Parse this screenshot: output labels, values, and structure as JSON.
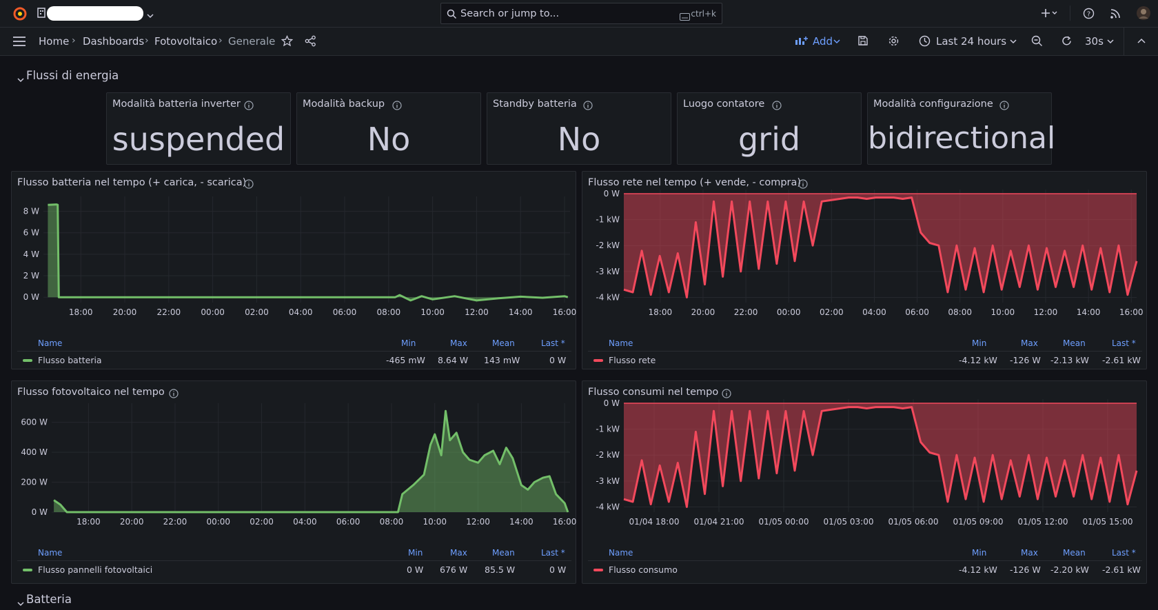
{
  "app": {
    "search_placeholder": "Search or jump to...",
    "search_shortcut": "ctrl+k"
  },
  "breadcrumb": [
    "Home",
    "Dashboards",
    "Fotovoltaico",
    "Generale"
  ],
  "toolbar": {
    "add_label": "Add",
    "time_range": "Last 24 hours",
    "refresh_interval": "30s"
  },
  "rows": {
    "energy_flows": "Flussi di energia",
    "battery": "Batteria"
  },
  "stats": [
    {
      "title": "Modalità batteria inverter",
      "value": "suspended"
    },
    {
      "title": "Modalità backup",
      "value": "No"
    },
    {
      "title": "Standby batteria",
      "value": "No"
    },
    {
      "title": "Luogo contatore",
      "value": "grid"
    },
    {
      "title": "Modalità configurazione",
      "value": "bidirectional"
    }
  ],
  "colors": {
    "green": "#73bf69",
    "red": "#f2495c",
    "link": "#6e9fff",
    "panel_bg": "#181b1f",
    "page_bg": "#111217"
  },
  "legend_headers": {
    "name": "Name",
    "min": "Min",
    "max": "Max",
    "mean": "Mean",
    "last": "Last *"
  },
  "panels": {
    "battery": {
      "title": "Flusso batteria nel tempo (+ carica, - scarica)",
      "series_name": "Flusso batteria",
      "min": "-465 mW",
      "max": "8.64 W",
      "mean": "143 mW",
      "last": "0 W"
    },
    "grid": {
      "title": "Flusso rete nel tempo (+ vende, - compra)",
      "series_name": "Flusso rete",
      "min": "-4.12 kW",
      "max": "-126 W",
      "mean": "-2.13 kW",
      "last": "-2.61 kW"
    },
    "pv": {
      "title": "Flusso fotovoltaico nel tempo",
      "series_name": "Flusso pannelli fotovoltaici",
      "min": "0 W",
      "max": "676 W",
      "mean": "85.5 W",
      "last": "0 W"
    },
    "consumption": {
      "title": "Flusso consumi nel tempo",
      "series_name": "Flusso consumo",
      "min": "-4.12 kW",
      "max": "-126 W",
      "mean": "-2.20 kW",
      "last": "-2.61 kW"
    }
  },
  "chart_data": [
    {
      "type": "line",
      "title": "Flusso batteria nel tempo (+ carica, - scarica)",
      "y_ticks": [
        "8 W",
        "6 W",
        "4 W",
        "2 W",
        "0 W"
      ],
      "x_ticks": [
        "18:00",
        "20:00",
        "22:00",
        "00:00",
        "02:00",
        "04:00",
        "06:00",
        "08:00",
        "10:00",
        "12:00",
        "14:00",
        "16:00"
      ],
      "ylim": [
        -0.5,
        9
      ],
      "series": [
        {
          "name": "Flusso batteria",
          "color": "#73bf69",
          "x": [
            16.5,
            16.9,
            16.95,
            17.0,
            8.3,
            8.5,
            9.0,
            9.5,
            10.0,
            11.0,
            12.0,
            13.0,
            14.0,
            15.0,
            16.0,
            16.15
          ],
          "values": [
            8.6,
            8.64,
            8.6,
            0,
            0,
            0.2,
            -0.3,
            0.1,
            -0.2,
            0.1,
            -0.3,
            -0.1,
            0.05,
            -0.05,
            0.1,
            0
          ]
        }
      ]
    },
    {
      "type": "area",
      "title": "Flusso rete nel tempo (+ vende, - compra)",
      "y_ticks": [
        "0 W",
        "-1 kW",
        "-2 kW",
        "-3 kW",
        "-4 kW"
      ],
      "x_ticks": [
        "18:00",
        "20:00",
        "22:00",
        "00:00",
        "02:00",
        "04:00",
        "06:00",
        "08:00",
        "10:00",
        "12:00",
        "14:00",
        "16:00"
      ],
      "ylim": [
        -4.2,
        0
      ],
      "series": [
        {
          "name": "Flusso rete",
          "color": "#f2495c",
          "values": [
            -3.7,
            -3.8,
            -2.2,
            -3.9,
            -2.4,
            -3.8,
            -2.3,
            -4.0,
            -1.1,
            -3.5,
            -0.3,
            -3.2,
            -0.3,
            -3.0,
            -0.3,
            -2.9,
            -0.3,
            -2.7,
            -0.3,
            -2.6,
            -0.3,
            -2.0,
            -0.3,
            -0.25,
            -0.2,
            -0.15,
            -0.15,
            -0.2,
            -0.15,
            -0.15,
            -0.15,
            -0.2,
            -0.15,
            -1.5,
            -1.9,
            -2.0,
            -3.8,
            -2.0,
            -3.7,
            -2.1,
            -3.8,
            -2.0,
            -3.7,
            -2.2,
            -3.6,
            -2.0,
            -3.7,
            -2.1,
            -3.6,
            -2.2,
            -3.6,
            -2.0,
            -3.7,
            -2.1,
            -3.8,
            -2.0,
            -3.9,
            -2.6
          ]
        }
      ]
    },
    {
      "type": "area",
      "title": "Flusso fotovoltaico nel tempo",
      "y_ticks": [
        "600 W",
        "400 W",
        "200 W",
        "0 W"
      ],
      "x_ticks": [
        "18:00",
        "20:00",
        "22:00",
        "00:00",
        "02:00",
        "04:00",
        "06:00",
        "08:00",
        "10:00",
        "12:00",
        "14:00",
        "16:00"
      ],
      "ylim": [
        0,
        700
      ],
      "series": [
        {
          "name": "Flusso pannelli fotovoltaici",
          "color": "#73bf69",
          "x": [
            16.4,
            16.7,
            17.0,
            8.3,
            8.5,
            9.0,
            9.5,
            9.8,
            10.0,
            10.3,
            10.5,
            10.7,
            11.0,
            11.3,
            11.6,
            12.0,
            12.3,
            12.7,
            13.0,
            13.3,
            13.6,
            14.0,
            14.3,
            14.6,
            15.0,
            15.3,
            15.6,
            16.0,
            16.15
          ],
          "values": [
            80,
            50,
            0,
            0,
            120,
            180,
            250,
            450,
            520,
            380,
            676,
            480,
            530,
            400,
            350,
            330,
            380,
            410,
            320,
            430,
            360,
            180,
            150,
            200,
            230,
            240,
            120,
            60,
            0
          ]
        }
      ]
    },
    {
      "type": "area",
      "title": "Flusso consumi nel tempo",
      "y_ticks": [
        "0 W",
        "-1 kW",
        "-2 kW",
        "-3 kW",
        "-4 kW"
      ],
      "x_ticks": [
        "01/04 18:00",
        "01/04 21:00",
        "01/05 00:00",
        "01/05 03:00",
        "01/05 06:00",
        "01/05 09:00",
        "01/05 12:00",
        "01/05 15:00"
      ],
      "ylim": [
        -4.2,
        0
      ],
      "series": [
        {
          "name": "Flusso consumo",
          "color": "#f2495c",
          "values": [
            -3.7,
            -3.8,
            -2.2,
            -3.9,
            -2.4,
            -3.8,
            -2.3,
            -4.0,
            -1.1,
            -3.5,
            -0.3,
            -3.2,
            -0.3,
            -3.0,
            -0.3,
            -2.9,
            -0.3,
            -2.7,
            -0.3,
            -2.6,
            -0.3,
            -2.0,
            -0.3,
            -0.25,
            -0.2,
            -0.15,
            -0.15,
            -0.2,
            -0.15,
            -0.15,
            -0.15,
            -0.2,
            -0.15,
            -1.5,
            -1.9,
            -2.0,
            -3.8,
            -2.0,
            -3.7,
            -2.1,
            -3.8,
            -2.0,
            -3.7,
            -2.2,
            -3.6,
            -2.0,
            -3.7,
            -2.1,
            -3.6,
            -2.2,
            -3.6,
            -2.0,
            -3.7,
            -2.1,
            -3.8,
            -2.0,
            -3.9,
            -2.6
          ]
        }
      ]
    }
  ]
}
